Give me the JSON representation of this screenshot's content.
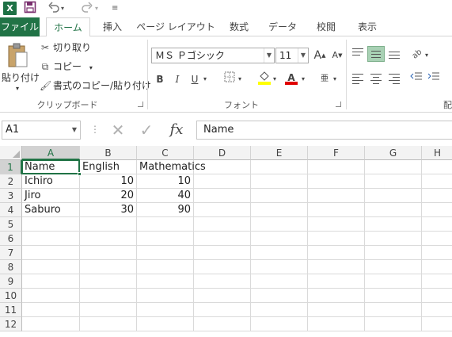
{
  "qat": {
    "app_logo": "X",
    "save_icon": "save-icon",
    "undo_icon": "undo-icon",
    "redo_icon": "redo-icon",
    "customize_icon": "customize-icon"
  },
  "tabs": [
    {
      "label": "ファイル"
    },
    {
      "label": "ホーム"
    },
    {
      "label": "挿入"
    },
    {
      "label": "ページ レイアウト"
    },
    {
      "label": "数式"
    },
    {
      "label": "データ"
    },
    {
      "label": "校閲"
    },
    {
      "label": "表示"
    }
  ],
  "clipboard": {
    "paste_label": "貼り付け",
    "cut_label": "切り取り",
    "copy_label": "コピー",
    "format_painter_label": "書式のコピー/貼り付け",
    "group_label": "クリップボード"
  },
  "font": {
    "font_name": "ＭＳ Ｐゴシック",
    "font_size": "11",
    "grow_label": "A",
    "shrink_label": "A",
    "bold": "B",
    "italic": "I",
    "underline": "U",
    "font_color_label": "A",
    "group_label": "フォント"
  },
  "alignment": {
    "group_label_partial": "配"
  },
  "formula_bar": {
    "name_box": "A1",
    "cancel_symbol": "✕",
    "enter_symbol": "✓",
    "fx_symbol": "fx",
    "content": "Name"
  },
  "grid": {
    "columns": [
      "A",
      "B",
      "C",
      "D",
      "E",
      "F",
      "G",
      "H"
    ],
    "rows": [
      "1",
      "2",
      "3",
      "4",
      "5",
      "6",
      "7",
      "8",
      "9",
      "10",
      "11",
      "12"
    ],
    "cells": {
      "A1": "Name",
      "B1": "English",
      "C1": "Mathematics",
      "A2": "Ichiro",
      "B2": "10",
      "C2": "10",
      "A3": "Jiro",
      "B3": "20",
      "C3": "40",
      "A4": "Saburo",
      "B4": "30",
      "C4": "90"
    },
    "active_cell": "A1"
  },
  "colors": {
    "accent": "#217346",
    "selected_align": "#a8d1b4",
    "font_color_bar": "#e00000",
    "highlight_bar": "#ffff00"
  }
}
